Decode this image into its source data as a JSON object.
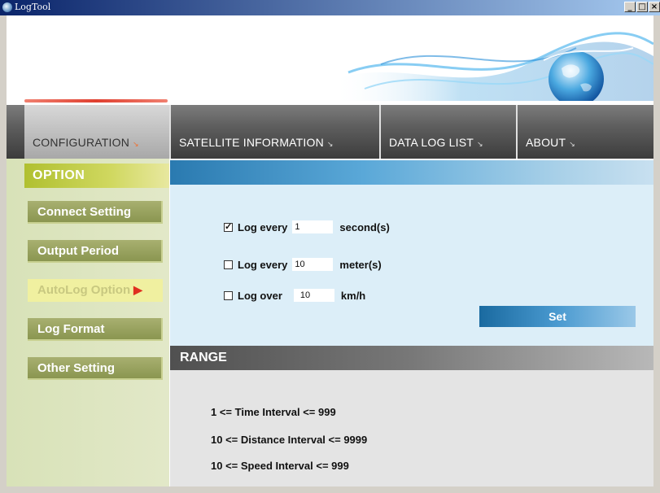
{
  "window": {
    "title": "LogTool",
    "buttons": [
      "_",
      "□",
      "×"
    ]
  },
  "tabs": [
    {
      "label": "CONFIGURATION",
      "arrow": "↘",
      "active": true
    },
    {
      "label": "SATELLITE  INFORMATION",
      "arrow": "↘",
      "active": false
    },
    {
      "label": "DATA  LOG  LIST",
      "arrow": "↘",
      "active": false
    },
    {
      "label": "ABOUT",
      "arrow": "↘",
      "active": false
    }
  ],
  "sidebar": {
    "heading": "OPTION",
    "items": [
      {
        "label": "Connect  Setting",
        "active": false
      },
      {
        "label": "Output  Period",
        "active": false
      },
      {
        "label": "AutoLog  Option",
        "active": true
      },
      {
        "label": "Log  Format",
        "active": false
      },
      {
        "label": "Other  Setting",
        "active": false
      }
    ]
  },
  "options": {
    "rows": [
      {
        "checked": true,
        "label": "Log every",
        "value": "1",
        "unit": "second(s)"
      },
      {
        "checked": false,
        "label": "Log every",
        "value": "10",
        "unit": "meter(s)"
      },
      {
        "checked": false,
        "label": "Log over",
        "value": "10",
        "unit": "km/h"
      }
    ],
    "set_label": "Set"
  },
  "range": {
    "heading": "RANGE",
    "lines": [
      "1 <= Time Interval <= 999",
      "10 <= Distance Interval <= 9999",
      "10 <= Speed Interval <= 999"
    ]
  },
  "colors": {
    "accent_blue": "#2a7ab0",
    "option_green": "#b0c030",
    "active_arrow": "#e03020"
  }
}
